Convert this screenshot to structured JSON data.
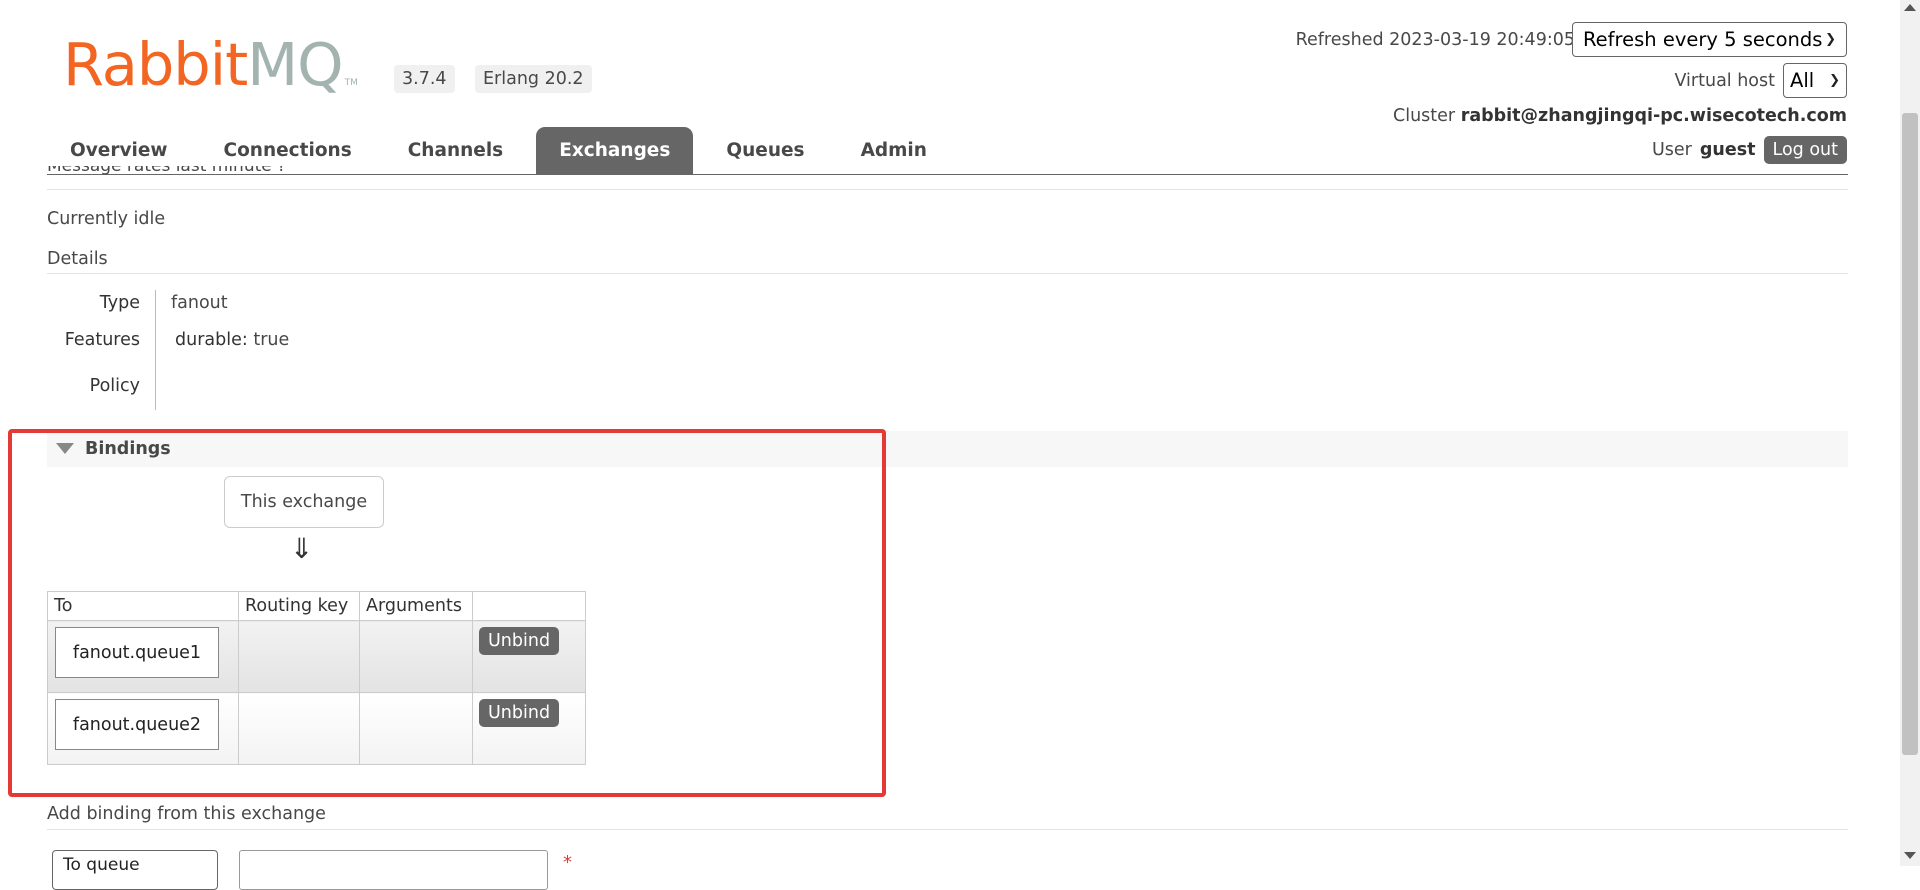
{
  "header": {
    "logo_text_a": "Rabbit",
    "logo_text_b": "MQ",
    "logo_tm": "TM",
    "version": "3.7.4",
    "erlang": "Erlang 20.2",
    "refreshed_label": "Refreshed 2023-03-19 20:49:05",
    "refresh_select": "Refresh every 5 seconds",
    "vhost_label": "Virtual host",
    "vhost_select": "All",
    "cluster_label": "Cluster",
    "cluster_value": "rabbit@zhangjingqi-pc.wisecotech.com",
    "user_label": "User",
    "user_value": "guest",
    "logout": "Log out"
  },
  "nav": {
    "tabs": [
      {
        "label": "Overview"
      },
      {
        "label": "Connections"
      },
      {
        "label": "Channels"
      },
      {
        "label": "Exchanges",
        "active": true
      },
      {
        "label": "Queues"
      },
      {
        "label": "Admin"
      }
    ]
  },
  "content": {
    "message_rates_clipped": "Message rates  last minute  ?",
    "idle": "Currently idle",
    "details": "Details",
    "type_label": "Type",
    "type_value": "fanout",
    "features_label": "Features",
    "durable_key": "durable:",
    "durable_value": "true",
    "policy_label": "Policy"
  },
  "bindings": {
    "title": "Bindings",
    "this_exchange": "This exchange",
    "arrow": "⇓",
    "columns": [
      "To",
      "Routing key",
      "Arguments",
      ""
    ],
    "rows": [
      {
        "to": "fanout.queue1",
        "routing_key": "",
        "arguments": "",
        "action": "Unbind"
      },
      {
        "to": "fanout.queue2",
        "routing_key": "",
        "arguments": "",
        "action": "Unbind"
      }
    ]
  },
  "add_binding": {
    "title": "Add binding from this exchange",
    "destination_select": "To queue",
    "required_mark": "*"
  },
  "colors": {
    "brand_orange": "#f26522",
    "nav_active": "#666666",
    "highlight": "#e53935"
  }
}
